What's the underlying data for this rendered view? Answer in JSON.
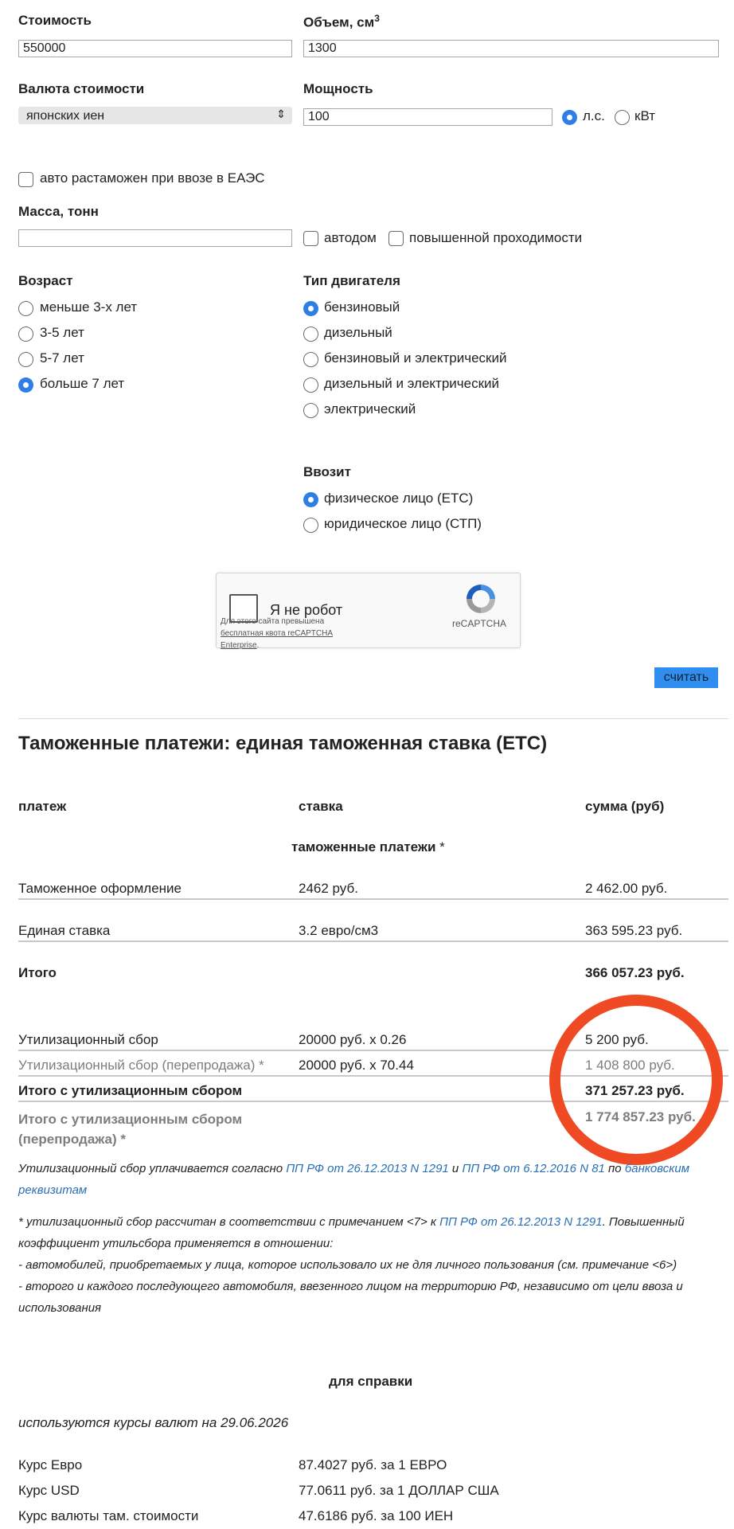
{
  "form": {
    "cost_label": "Стоимость",
    "cost_value": "550000",
    "volume_label": "Объем, см",
    "volume_sup": "3",
    "volume_value": "1300",
    "currency_label": "Валюта стоимости",
    "currency_selected": "японских иен",
    "power_label": "Мощность",
    "power_value": "100",
    "power_unit_hp": "л.с.",
    "power_unit_kw": "кВт",
    "eaes_label": "авто растаможен при ввозе в ЕАЭС",
    "mass_label": "Масса, тонн",
    "mass_value": "",
    "autohome_label": "автодом",
    "offroad_label": "повышенной проходимости",
    "age_label": "Возраст",
    "age_options": [
      "меньше 3-х лет",
      "3-5 лет",
      "5-7 лет",
      "больше 7 лет"
    ],
    "engine_label": "Тип двигателя",
    "engine_options": [
      "бензиновый",
      "дизельный",
      "бензиновый и электрический",
      "дизельный и электрический",
      "электрический"
    ],
    "importer_label": "Ввозит",
    "importer_options": [
      "физическое лицо (ЕТС)",
      "юридическое лицо (СТП)"
    ],
    "captcha_label": "Я не робот",
    "captcha_quota_1": "Для этого сайта превышена",
    "captcha_quota_2": "бесплатная квота reCAPTCHA",
    "captcha_quota_3": "Enterprise",
    "captcha_brand": "reCAPTCHA",
    "submit_label": "считать"
  },
  "results": {
    "title": "Таможенные платежи: единая таможенная ставка (ЕТС)",
    "col_payment": "платеж",
    "col_rate": "ставка",
    "col_sum": "сумма (руб)",
    "section_title": "таможенные платежи",
    "section_star": "*",
    "rows": [
      {
        "name": "Таможенное оформление",
        "rate": "2462 руб.",
        "sum": "2 462.00 руб."
      },
      {
        "name": "Единая ставка",
        "rate": "3.2 евро/см3",
        "sum": "363 595.23 руб."
      }
    ],
    "total_label": "Итого",
    "total_sum": "366 057.23 руб.",
    "util_label": "Утилизационный сбор",
    "util_rate": "20000 руб. x 0.26",
    "util_sum": "5 200 руб.",
    "util_resale_label": "Утилизационный сбор (перепродажа) *",
    "util_resale_rate": "20000 руб. x 70.44",
    "util_resale_sum": "1 408 800 руб.",
    "total_util_label": "Итого с утилизационным сбором",
    "total_util_sum": "371 257.23 руб.",
    "total_util_resale_label_1": "Итого с утилизационным сбором",
    "total_util_resale_label_2": "(перепродажа) *",
    "total_util_resale_sum": "1 774 857.23 руб."
  },
  "notes": {
    "pay_1": "Утилизационный сбор уплачивается согласно ",
    "pay_link_1": "ПП РФ от 26.12.2013 N 1291",
    "pay_2": " и ",
    "pay_link_2": "ПП РФ от 6.12.2016 N 81",
    "pay_3": " по ",
    "pay_link_3": "банковским",
    "pay_link_4": "реквизитам",
    "star_1": "* утилизационный сбор рассчитан в соответствии с примечанием <7> к ",
    "star_link": "ПП РФ от 26.12.2013 N 1291",
    "star_2": ". Повышенный",
    "star_3": "коэффициент утильсбора применяется в отношении:",
    "star_4": "- автомобилей, приобретаемых у лица, которое использовало их не для личного пользования (см. примечание <6>)",
    "star_5": "- второго и каждого последующего автомобиля, ввезенного лицом на территорию РФ, независимо от цели ввоза и",
    "star_6": "использования"
  },
  "reference": {
    "title": "для справки",
    "rates_date": "используются курсы валют на 29.06.2026",
    "rows": [
      {
        "name": "Курс Евро",
        "value": "87.4027 руб. за 1 ЕВРО"
      },
      {
        "name": "Курс USD",
        "value": "77.0611 руб. за 1 ДОЛЛАР США"
      },
      {
        "name": "Курс валюты там. стоимости",
        "value": "47.6186 руб. за 100 ИЕН"
      }
    ]
  },
  "colors": {
    "accent": "#2f7ee6",
    "button": "#2f8ef0",
    "link": "#2a6fb5",
    "highlight_circle": "#f04a24",
    "muted_text": "#7d7d7d"
  }
}
